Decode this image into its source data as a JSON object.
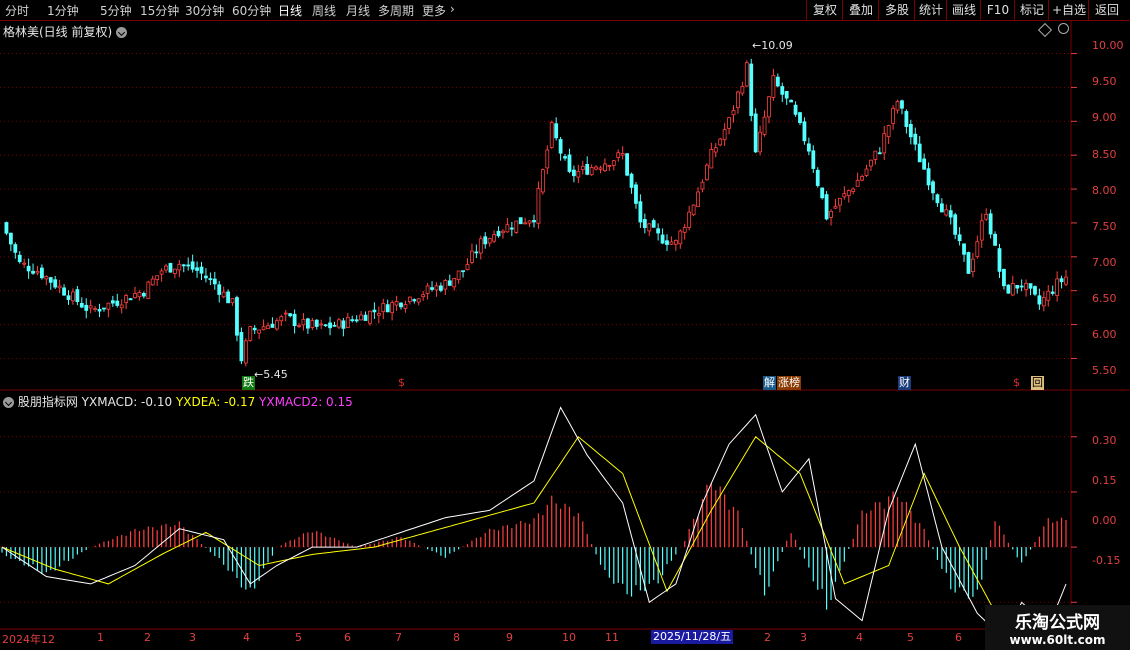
{
  "toolbar": {
    "periods": [
      "分时",
      "1分钟",
      "5分钟",
      "15分钟",
      "30分钟",
      "60分钟",
      "日线",
      "周线",
      "月线",
      "多周期",
      "更多"
    ],
    "active_period": "日线",
    "right_buttons": [
      "复权",
      "叠加",
      "多股",
      "统计",
      "画线",
      "F10",
      "标记",
      "+自选",
      "返回"
    ]
  },
  "stock": {
    "title": "格林美(日线 前复权)"
  },
  "indicator": {
    "name": "股朋指标网",
    "macd_label": "YXMACD: -0.10",
    "dea_label": "YXDEA: -0.17",
    "macd2_label": "YXMACD2: 0.15"
  },
  "price_axis": [
    "10.00",
    "9.50",
    "9.00",
    "8.50",
    "8.00",
    "7.50",
    "7.00",
    "6.50",
    "6.00",
    "5.50"
  ],
  "indicator_axis": [
    "0.30",
    "0.15",
    "0.00",
    "-0.15"
  ],
  "annotations": {
    "high": "10.09",
    "low": "5.45"
  },
  "markers": [
    {
      "text": "跌",
      "color": "#ffffff",
      "bg": "#127a12"
    },
    {
      "text": "$",
      "color": "#e03030",
      "bg": "transparent"
    },
    {
      "text": "解",
      "color": "#ffffff",
      "bg": "#1a5a8a"
    },
    {
      "text": "涨榜",
      "color": "#ffffff",
      "bg": "#8a3a00"
    },
    {
      "text": "财",
      "color": "#ffffff",
      "bg": "#1a3a7a"
    },
    {
      "text": "$",
      "color": "#e03030",
      "bg": "transparent"
    },
    {
      "text": "回",
      "color": "#000000",
      "bg": "#e0c080"
    }
  ],
  "date_axis": [
    "2024年12",
    "1",
    "2",
    "3",
    "4",
    "5",
    "6",
    "7",
    "8",
    "9",
    "10",
    "11",
    "2025/11/28/五",
    "2",
    "3",
    "4",
    "5",
    "6"
  ],
  "watermark": {
    "main": "乐淘公式网",
    "url": "www.60lt.com"
  },
  "colors": {
    "up": "#ff4040",
    "down": "#54ffff",
    "macd": "#ffffff",
    "dea": "#ffff00",
    "grid": "#7a0000"
  },
  "chart_data": {
    "type": "candlestick",
    "price_range": [
      5.3,
      10.2
    ],
    "indicator_range": [
      -0.22,
      0.4
    ],
    "close_path": [
      {
        "i": 0,
        "p": 7.5
      },
      {
        "i": 4,
        "p": 6.9
      },
      {
        "i": 8,
        "p": 6.8
      },
      {
        "i": 12,
        "p": 6.6
      },
      {
        "i": 16,
        "p": 6.4
      },
      {
        "i": 20,
        "p": 6.2
      },
      {
        "i": 24,
        "p": 6.3
      },
      {
        "i": 28,
        "p": 6.4
      },
      {
        "i": 32,
        "p": 6.5
      },
      {
        "i": 36,
        "p": 6.8
      },
      {
        "i": 40,
        "p": 6.9
      },
      {
        "i": 44,
        "p": 6.8
      },
      {
        "i": 48,
        "p": 6.6
      },
      {
        "i": 52,
        "p": 6.3
      },
      {
        "i": 54,
        "p": 5.5
      },
      {
        "i": 56,
        "p": 5.9
      },
      {
        "i": 60,
        "p": 6.0
      },
      {
        "i": 64,
        "p": 6.1
      },
      {
        "i": 68,
        "p": 6.0
      },
      {
        "i": 72,
        "p": 5.95
      },
      {
        "i": 76,
        "p": 6.0
      },
      {
        "i": 80,
        "p": 6.1
      },
      {
        "i": 84,
        "p": 6.2
      },
      {
        "i": 88,
        "p": 6.3
      },
      {
        "i": 92,
        "p": 6.4
      },
      {
        "i": 96,
        "p": 6.5
      },
      {
        "i": 100,
        "p": 6.6
      },
      {
        "i": 104,
        "p": 6.8
      },
      {
        "i": 108,
        "p": 7.2
      },
      {
        "i": 112,
        "p": 7.4
      },
      {
        "i": 116,
        "p": 7.5
      },
      {
        "i": 120,
        "p": 7.6
      },
      {
        "i": 124,
        "p": 8.9
      },
      {
        "i": 128,
        "p": 8.2
      },
      {
        "i": 132,
        "p": 8.3
      },
      {
        "i": 136,
        "p": 8.4
      },
      {
        "i": 140,
        "p": 8.5
      },
      {
        "i": 144,
        "p": 7.5
      },
      {
        "i": 148,
        "p": 7.3
      },
      {
        "i": 152,
        "p": 7.2
      },
      {
        "i": 156,
        "p": 7.8
      },
      {
        "i": 160,
        "p": 8.5
      },
      {
        "i": 164,
        "p": 9.0
      },
      {
        "i": 168,
        "p": 9.8
      },
      {
        "i": 170,
        "p": 8.5
      },
      {
        "i": 174,
        "p": 9.6
      },
      {
        "i": 178,
        "p": 9.2
      },
      {
        "i": 182,
        "p": 8.6
      },
      {
        "i": 186,
        "p": 7.6
      },
      {
        "i": 190,
        "p": 7.9
      },
      {
        "i": 194,
        "p": 8.2
      },
      {
        "i": 198,
        "p": 8.6
      },
      {
        "i": 202,
        "p": 9.3
      },
      {
        "i": 206,
        "p": 8.6
      },
      {
        "i": 210,
        "p": 8.0
      },
      {
        "i": 214,
        "p": 7.5
      },
      {
        "i": 218,
        "p": 6.8
      },
      {
        "i": 222,
        "p": 7.7
      },
      {
        "i": 226,
        "p": 6.5
      },
      {
        "i": 230,
        "p": 6.6
      },
      {
        "i": 234,
        "p": 6.3
      },
      {
        "i": 238,
        "p": 6.6
      },
      {
        "i": 240,
        "p": 6.7
      }
    ],
    "macd_hist": [
      {
        "i": 0,
        "v": -0.02
      },
      {
        "i": 10,
        "v": -0.08
      },
      {
        "i": 20,
        "v": 0.0
      },
      {
        "i": 30,
        "v": 0.05
      },
      {
        "i": 40,
        "v": 0.07
      },
      {
        "i": 50,
        "v": -0.05
      },
      {
        "i": 56,
        "v": -0.14
      },
      {
        "i": 62,
        "v": 0.0
      },
      {
        "i": 70,
        "v": 0.05
      },
      {
        "i": 80,
        "v": 0.0
      },
      {
        "i": 90,
        "v": 0.03
      },
      {
        "i": 100,
        "v": -0.03
      },
      {
        "i": 110,
        "v": 0.05
      },
      {
        "i": 120,
        "v": 0.08
      },
      {
        "i": 124,
        "v": 0.14
      },
      {
        "i": 130,
        "v": 0.1
      },
      {
        "i": 136,
        "v": -0.08
      },
      {
        "i": 142,
        "v": -0.14
      },
      {
        "i": 148,
        "v": -0.1
      },
      {
        "i": 154,
        "v": 0.02
      },
      {
        "i": 160,
        "v": 0.2
      },
      {
        "i": 166,
        "v": 0.1
      },
      {
        "i": 172,
        "v": -0.14
      },
      {
        "i": 178,
        "v": 0.05
      },
      {
        "i": 186,
        "v": -0.18
      },
      {
        "i": 194,
        "v": 0.1
      },
      {
        "i": 202,
        "v": 0.16
      },
      {
        "i": 208,
        "v": 0.05
      },
      {
        "i": 214,
        "v": -0.12
      },
      {
        "i": 220,
        "v": -0.15
      },
      {
        "i": 224,
        "v": 0.08
      },
      {
        "i": 230,
        "v": -0.05
      },
      {
        "i": 236,
        "v": 0.08
      },
      {
        "i": 240,
        "v": 0.08
      }
    ],
    "yxmacd": [
      {
        "i": 0,
        "v": 0.0
      },
      {
        "i": 10,
        "v": -0.08
      },
      {
        "i": 20,
        "v": -0.1
      },
      {
        "i": 30,
        "v": -0.05
      },
      {
        "i": 40,
        "v": 0.05
      },
      {
        "i": 50,
        "v": 0.02
      },
      {
        "i": 56,
        "v": -0.1
      },
      {
        "i": 62,
        "v": -0.05
      },
      {
        "i": 70,
        "v": 0.0
      },
      {
        "i": 80,
        "v": 0.0
      },
      {
        "i": 90,
        "v": 0.04
      },
      {
        "i": 100,
        "v": 0.08
      },
      {
        "i": 110,
        "v": 0.1
      },
      {
        "i": 120,
        "v": 0.18
      },
      {
        "i": 126,
        "v": 0.38
      },
      {
        "i": 132,
        "v": 0.25
      },
      {
        "i": 140,
        "v": 0.12
      },
      {
        "i": 146,
        "v": -0.15
      },
      {
        "i": 152,
        "v": -0.1
      },
      {
        "i": 158,
        "v": 0.12
      },
      {
        "i": 164,
        "v": 0.28
      },
      {
        "i": 170,
        "v": 0.36
      },
      {
        "i": 176,
        "v": 0.15
      },
      {
        "i": 182,
        "v": 0.24
      },
      {
        "i": 188,
        "v": -0.14
      },
      {
        "i": 194,
        "v": -0.2
      },
      {
        "i": 200,
        "v": 0.1
      },
      {
        "i": 206,
        "v": 0.28
      },
      {
        "i": 212,
        "v": 0.0
      },
      {
        "i": 220,
        "v": -0.18
      },
      {
        "i": 226,
        "v": -0.25
      },
      {
        "i": 230,
        "v": -0.15
      },
      {
        "i": 236,
        "v": -0.22
      },
      {
        "i": 240,
        "v": -0.1
      }
    ],
    "yxdea": [
      {
        "i": 0,
        "v": 0.0
      },
      {
        "i": 12,
        "v": -0.06
      },
      {
        "i": 24,
        "v": -0.1
      },
      {
        "i": 36,
        "v": -0.02
      },
      {
        "i": 46,
        "v": 0.04
      },
      {
        "i": 58,
        "v": -0.05
      },
      {
        "i": 70,
        "v": -0.02
      },
      {
        "i": 84,
        "v": 0.0
      },
      {
        "i": 96,
        "v": 0.04
      },
      {
        "i": 108,
        "v": 0.08
      },
      {
        "i": 120,
        "v": 0.12
      },
      {
        "i": 130,
        "v": 0.3
      },
      {
        "i": 140,
        "v": 0.2
      },
      {
        "i": 150,
        "v": -0.12
      },
      {
        "i": 160,
        "v": 0.1
      },
      {
        "i": 170,
        "v": 0.3
      },
      {
        "i": 180,
        "v": 0.2
      },
      {
        "i": 190,
        "v": -0.1
      },
      {
        "i": 200,
        "v": -0.05
      },
      {
        "i": 208,
        "v": 0.2
      },
      {
        "i": 216,
        "v": 0.0
      },
      {
        "i": 226,
        "v": -0.22
      },
      {
        "i": 234,
        "v": -0.2
      },
      {
        "i": 240,
        "v": -0.17
      }
    ]
  }
}
